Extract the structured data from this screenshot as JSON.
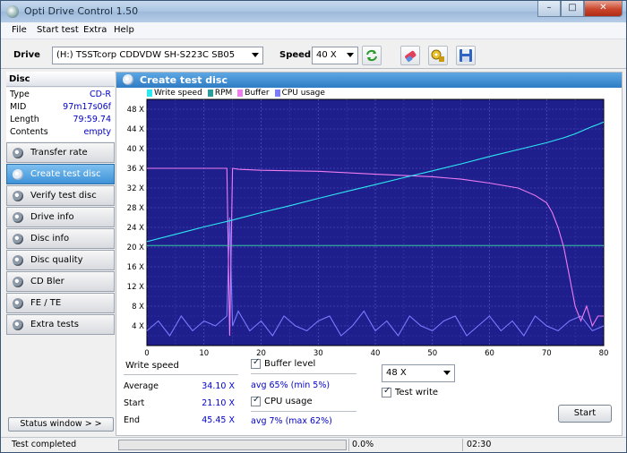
{
  "window": {
    "title": "Opti Drive Control 1.50",
    "minimize": "–",
    "maximize": "□",
    "close": "✕"
  },
  "menu": [
    "File",
    "Start test",
    "Extra",
    "Help"
  ],
  "toolbar": {
    "drive_label": "Drive",
    "drive_value": "(H:)   TSSTcorp CDDVDW SH-S223C SB05",
    "speed_label": "Speed",
    "speed_value": "40 X",
    "icons": [
      "refresh-icon",
      "eraser-icon",
      "disc-info-icon",
      "save-icon"
    ]
  },
  "disc": {
    "header": "Disc",
    "rows": [
      {
        "key": "Type",
        "value": "CD-R"
      },
      {
        "key": "MID",
        "value": "97m17s06f"
      },
      {
        "key": "Length",
        "value": "79:59.74"
      },
      {
        "key": "Contents",
        "value": "empty"
      }
    ]
  },
  "nav": [
    {
      "label": "Transfer rate",
      "active": false
    },
    {
      "label": "Create test disc",
      "active": true
    },
    {
      "label": "Verify test disc",
      "active": false
    },
    {
      "label": "Drive info",
      "active": false
    },
    {
      "label": "Disc info",
      "active": false
    },
    {
      "label": "Disc quality",
      "active": false
    },
    {
      "label": "CD Bler",
      "active": false
    },
    {
      "label": "FE / TE",
      "active": false
    },
    {
      "label": "Extra tests",
      "active": false
    }
  ],
  "status_window_button": "Status window > >",
  "panel": {
    "title": "Create test disc"
  },
  "chart_data": {
    "type": "line",
    "legend": [
      {
        "name": "Write speed",
        "color": "#2ee8f0"
      },
      {
        "name": "RPM",
        "color": "#2c9b9b"
      },
      {
        "name": "Buffer",
        "color": "#f07cf0"
      },
      {
        "name": "CPU usage",
        "color": "#7b7bff"
      }
    ],
    "x_ticks": [
      "0",
      "10",
      "20",
      "30",
      "40",
      "50",
      "60",
      "70",
      "80"
    ],
    "y_ticks": [
      "4 X",
      "8 X",
      "12 X",
      "16 X",
      "20 X",
      "24 X",
      "28 X",
      "32 X",
      "36 X",
      "40 X",
      "44 X",
      "48 X"
    ],
    "xlim": [
      0,
      80
    ],
    "ylim": [
      0,
      50
    ],
    "grid": true,
    "series": [
      {
        "name": "Write speed",
        "x": [
          0,
          5,
          10,
          15,
          20,
          25,
          30,
          35,
          40,
          45,
          50,
          55,
          60,
          65,
          70,
          73,
          75,
          76,
          77,
          78,
          79,
          80
        ],
        "y": [
          21.1,
          22.6,
          24.1,
          25.5,
          27.0,
          28.4,
          29.9,
          31.3,
          32.7,
          34.1,
          35.5,
          36.9,
          38.4,
          39.8,
          41.2,
          42.2,
          43.0,
          43.5,
          44.0,
          44.5,
          44.9,
          45.4
        ]
      },
      {
        "name": "RPM",
        "x": [
          0,
          10,
          20,
          30,
          40,
          50,
          60,
          70,
          80
        ],
        "y": [
          20.3,
          20.3,
          20.3,
          20.3,
          20.3,
          20.3,
          20.3,
          20.3,
          20.3
        ]
      },
      {
        "name": "Buffer",
        "x": [
          0,
          14,
          14.5,
          15,
          16,
          20,
          30,
          35,
          40,
          50,
          55,
          60,
          65,
          68,
          70,
          71,
          72,
          73,
          74,
          75,
          76,
          77,
          78,
          79,
          80
        ],
        "y": [
          36,
          36,
          2,
          36,
          35.8,
          35.6,
          35.4,
          35.1,
          34.8,
          34.3,
          33.8,
          33.0,
          32.0,
          30.5,
          29,
          27,
          24,
          20,
          14,
          8,
          5,
          8,
          4,
          6,
          6
        ]
      },
      {
        "name": "CPU usage",
        "x": [
          0,
          2,
          4,
          6,
          8,
          10,
          12,
          14,
          14.5,
          15,
          16,
          18,
          20,
          22,
          24,
          26,
          28,
          30,
          32,
          34,
          36,
          38,
          40,
          42,
          44,
          46,
          48,
          50,
          52,
          54,
          56,
          58,
          60,
          62,
          64,
          66,
          68,
          70,
          72,
          74,
          76,
          78,
          80
        ],
        "y": [
          3,
          5,
          2,
          6,
          3,
          5,
          4,
          6,
          26,
          4,
          7,
          3,
          5,
          2,
          6,
          4,
          3,
          5,
          6,
          2,
          4,
          7,
          3,
          5,
          2,
          6,
          4,
          3,
          5,
          6,
          2,
          4,
          6,
          3,
          5,
          2,
          6,
          4,
          3,
          5,
          6,
          3,
          4
        ]
      }
    ]
  },
  "stats": {
    "title": "Write speed",
    "rows": [
      {
        "key": "Average",
        "value": "34.10 X"
      },
      {
        "key": "Start",
        "value": "21.10 X"
      },
      {
        "key": "End",
        "value": "45.45 X"
      }
    ],
    "buffer_label": "Buffer level",
    "buffer_avg": "avg 65% (min 5%)",
    "cpu_label": "CPU usage",
    "cpu_avg": "avg 7% (max 62%)",
    "speed_select": "48 X",
    "test_write_label": "Test write",
    "start_button": "Start"
  },
  "statusbar": {
    "text": "Test completed",
    "progress": 0,
    "percent": "0.0%",
    "time": "02:30"
  }
}
